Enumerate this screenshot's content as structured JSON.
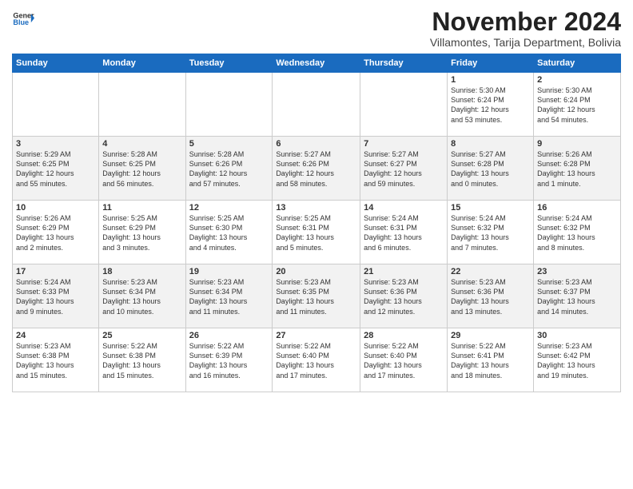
{
  "header": {
    "logo_line1": "General",
    "logo_line2": "Blue",
    "month_title": "November 2024",
    "subtitle": "Villamontes, Tarija Department, Bolivia"
  },
  "weekdays": [
    "Sunday",
    "Monday",
    "Tuesday",
    "Wednesday",
    "Thursday",
    "Friday",
    "Saturday"
  ],
  "weeks": [
    [
      {
        "day": "",
        "info": ""
      },
      {
        "day": "",
        "info": ""
      },
      {
        "day": "",
        "info": ""
      },
      {
        "day": "",
        "info": ""
      },
      {
        "day": "",
        "info": ""
      },
      {
        "day": "1",
        "info": "Sunrise: 5:30 AM\nSunset: 6:24 PM\nDaylight: 12 hours\nand 53 minutes."
      },
      {
        "day": "2",
        "info": "Sunrise: 5:30 AM\nSunset: 6:24 PM\nDaylight: 12 hours\nand 54 minutes."
      }
    ],
    [
      {
        "day": "3",
        "info": "Sunrise: 5:29 AM\nSunset: 6:25 PM\nDaylight: 12 hours\nand 55 minutes."
      },
      {
        "day": "4",
        "info": "Sunrise: 5:28 AM\nSunset: 6:25 PM\nDaylight: 12 hours\nand 56 minutes."
      },
      {
        "day": "5",
        "info": "Sunrise: 5:28 AM\nSunset: 6:26 PM\nDaylight: 12 hours\nand 57 minutes."
      },
      {
        "day": "6",
        "info": "Sunrise: 5:27 AM\nSunset: 6:26 PM\nDaylight: 12 hours\nand 58 minutes."
      },
      {
        "day": "7",
        "info": "Sunrise: 5:27 AM\nSunset: 6:27 PM\nDaylight: 12 hours\nand 59 minutes."
      },
      {
        "day": "8",
        "info": "Sunrise: 5:27 AM\nSunset: 6:28 PM\nDaylight: 13 hours\nand 0 minutes."
      },
      {
        "day": "9",
        "info": "Sunrise: 5:26 AM\nSunset: 6:28 PM\nDaylight: 13 hours\nand 1 minute."
      }
    ],
    [
      {
        "day": "10",
        "info": "Sunrise: 5:26 AM\nSunset: 6:29 PM\nDaylight: 13 hours\nand 2 minutes."
      },
      {
        "day": "11",
        "info": "Sunrise: 5:25 AM\nSunset: 6:29 PM\nDaylight: 13 hours\nand 3 minutes."
      },
      {
        "day": "12",
        "info": "Sunrise: 5:25 AM\nSunset: 6:30 PM\nDaylight: 13 hours\nand 4 minutes."
      },
      {
        "day": "13",
        "info": "Sunrise: 5:25 AM\nSunset: 6:31 PM\nDaylight: 13 hours\nand 5 minutes."
      },
      {
        "day": "14",
        "info": "Sunrise: 5:24 AM\nSunset: 6:31 PM\nDaylight: 13 hours\nand 6 minutes."
      },
      {
        "day": "15",
        "info": "Sunrise: 5:24 AM\nSunset: 6:32 PM\nDaylight: 13 hours\nand 7 minutes."
      },
      {
        "day": "16",
        "info": "Sunrise: 5:24 AM\nSunset: 6:32 PM\nDaylight: 13 hours\nand 8 minutes."
      }
    ],
    [
      {
        "day": "17",
        "info": "Sunrise: 5:24 AM\nSunset: 6:33 PM\nDaylight: 13 hours\nand 9 minutes."
      },
      {
        "day": "18",
        "info": "Sunrise: 5:23 AM\nSunset: 6:34 PM\nDaylight: 13 hours\nand 10 minutes."
      },
      {
        "day": "19",
        "info": "Sunrise: 5:23 AM\nSunset: 6:34 PM\nDaylight: 13 hours\nand 11 minutes."
      },
      {
        "day": "20",
        "info": "Sunrise: 5:23 AM\nSunset: 6:35 PM\nDaylight: 13 hours\nand 11 minutes."
      },
      {
        "day": "21",
        "info": "Sunrise: 5:23 AM\nSunset: 6:36 PM\nDaylight: 13 hours\nand 12 minutes."
      },
      {
        "day": "22",
        "info": "Sunrise: 5:23 AM\nSunset: 6:36 PM\nDaylight: 13 hours\nand 13 minutes."
      },
      {
        "day": "23",
        "info": "Sunrise: 5:23 AM\nSunset: 6:37 PM\nDaylight: 13 hours\nand 14 minutes."
      }
    ],
    [
      {
        "day": "24",
        "info": "Sunrise: 5:23 AM\nSunset: 6:38 PM\nDaylight: 13 hours\nand 15 minutes."
      },
      {
        "day": "25",
        "info": "Sunrise: 5:22 AM\nSunset: 6:38 PM\nDaylight: 13 hours\nand 15 minutes."
      },
      {
        "day": "26",
        "info": "Sunrise: 5:22 AM\nSunset: 6:39 PM\nDaylight: 13 hours\nand 16 minutes."
      },
      {
        "day": "27",
        "info": "Sunrise: 5:22 AM\nSunset: 6:40 PM\nDaylight: 13 hours\nand 17 minutes."
      },
      {
        "day": "28",
        "info": "Sunrise: 5:22 AM\nSunset: 6:40 PM\nDaylight: 13 hours\nand 17 minutes."
      },
      {
        "day": "29",
        "info": "Sunrise: 5:22 AM\nSunset: 6:41 PM\nDaylight: 13 hours\nand 18 minutes."
      },
      {
        "day": "30",
        "info": "Sunrise: 5:23 AM\nSunset: 6:42 PM\nDaylight: 13 hours\nand 19 minutes."
      }
    ]
  ]
}
